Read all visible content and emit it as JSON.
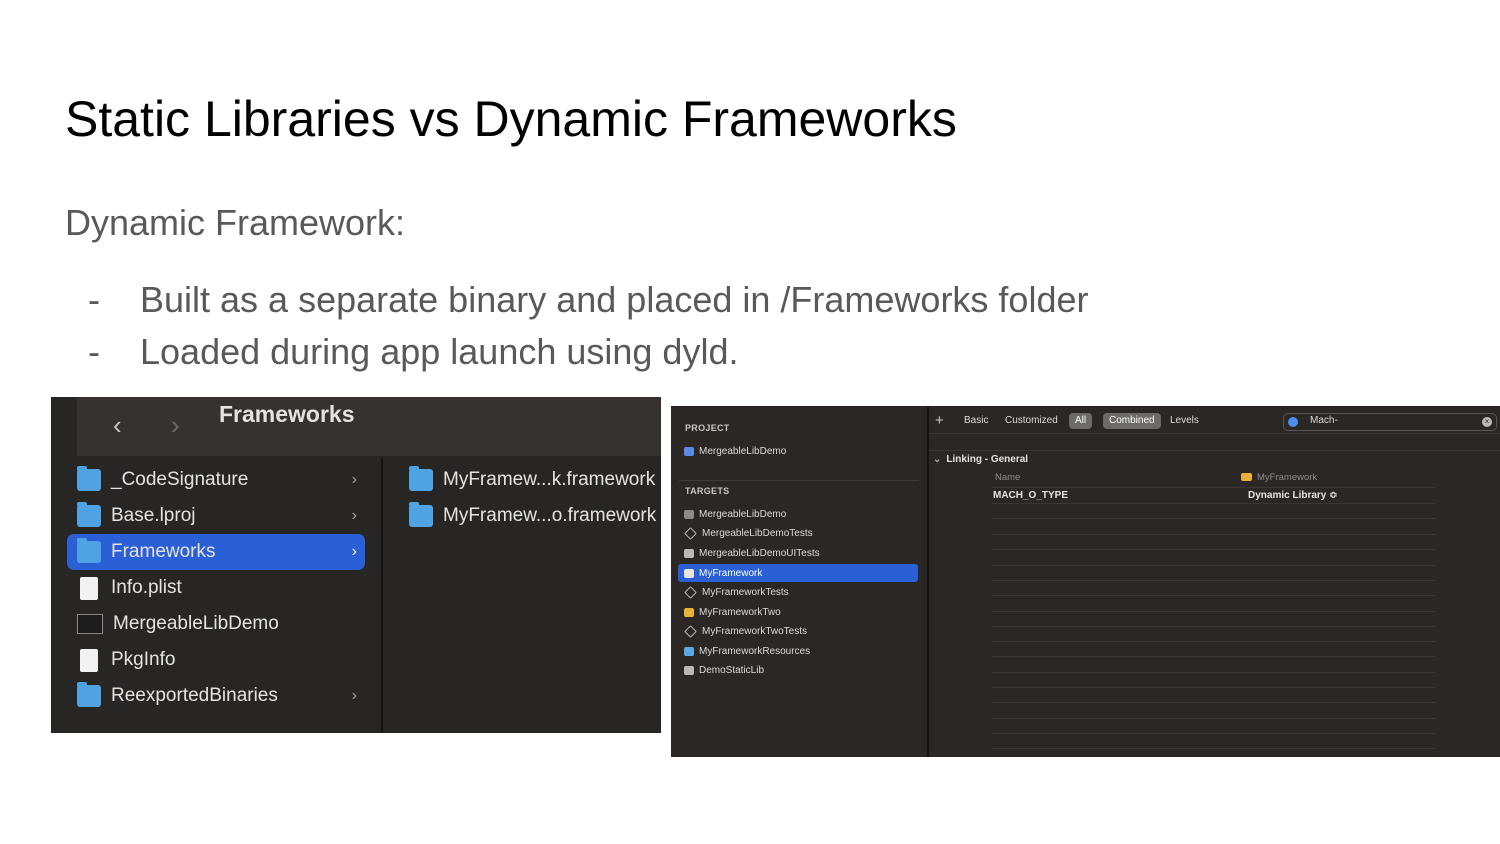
{
  "slide": {
    "title": "Static Libraries vs Dynamic Frameworks",
    "subtitle": "Dynamic Framework:",
    "bullets": [
      "Built as a separate binary and placed in /Frameworks folder",
      "Loaded during app launch using dyld."
    ],
    "bullet_marker": "-"
  },
  "finder": {
    "title": "Frameworks",
    "back_icon": "chevron-left-icon",
    "forward_icon": "chevron-right-icon",
    "column1": [
      {
        "label": "_CodeSignature",
        "icon": "folder-icon",
        "has_children": true
      },
      {
        "label": "Base.lproj",
        "icon": "folder-icon",
        "has_children": true
      },
      {
        "label": "Frameworks",
        "icon": "folder-icon",
        "has_children": true,
        "selected": true
      },
      {
        "label": "Info.plist",
        "icon": "plist-file-icon",
        "has_children": false
      },
      {
        "label": "MergeableLibDemo",
        "icon": "executable-icon",
        "has_children": false
      },
      {
        "label": "PkgInfo",
        "icon": "file-icon",
        "has_children": false
      },
      {
        "label": "ReexportedBinaries",
        "icon": "folder-icon",
        "has_children": true
      }
    ],
    "column2": [
      {
        "label": "MyFramew...k.framework",
        "icon": "folder-icon"
      },
      {
        "label": "MyFramew...o.framework",
        "icon": "folder-icon"
      }
    ]
  },
  "xcode": {
    "sidebar": {
      "project_header": "PROJECT",
      "project": {
        "label": "MergeableLibDemo",
        "icon": "app-project-icon"
      },
      "targets_header": "TARGETS",
      "targets": [
        {
          "label": "MergeableLibDemo",
          "icon": "app-target-icon"
        },
        {
          "label": "MergeableLibDemoTests",
          "icon": "test-target-icon"
        },
        {
          "label": "MergeableLibDemoUITests",
          "icon": "ui-test-target-icon"
        },
        {
          "label": "MyFramework",
          "icon": "framework-target-icon",
          "selected": true
        },
        {
          "label": "MyFrameworkTests",
          "icon": "test-target-icon"
        },
        {
          "label": "MyFrameworkTwo",
          "icon": "framework-target-icon"
        },
        {
          "label": "MyFrameworkTwoTests",
          "icon": "test-target-icon"
        },
        {
          "label": "MyFrameworkResources",
          "icon": "bundle-target-icon"
        },
        {
          "label": "DemoStaticLib",
          "icon": "static-library-icon"
        }
      ]
    },
    "toolbar": {
      "add_label": "+",
      "basic": "Basic",
      "customized": "Customized",
      "all": "All",
      "combined": "Combined",
      "levels": "Levels",
      "search_value": "Mach-",
      "search_clear": "×"
    },
    "settings": {
      "group": "Linking - General",
      "group_caret": "⌄",
      "col_name": "Name",
      "col_target": "MyFramework",
      "setting_name": "MACH_O_TYPE",
      "setting_value": "Dynamic Library ≎"
    }
  }
}
